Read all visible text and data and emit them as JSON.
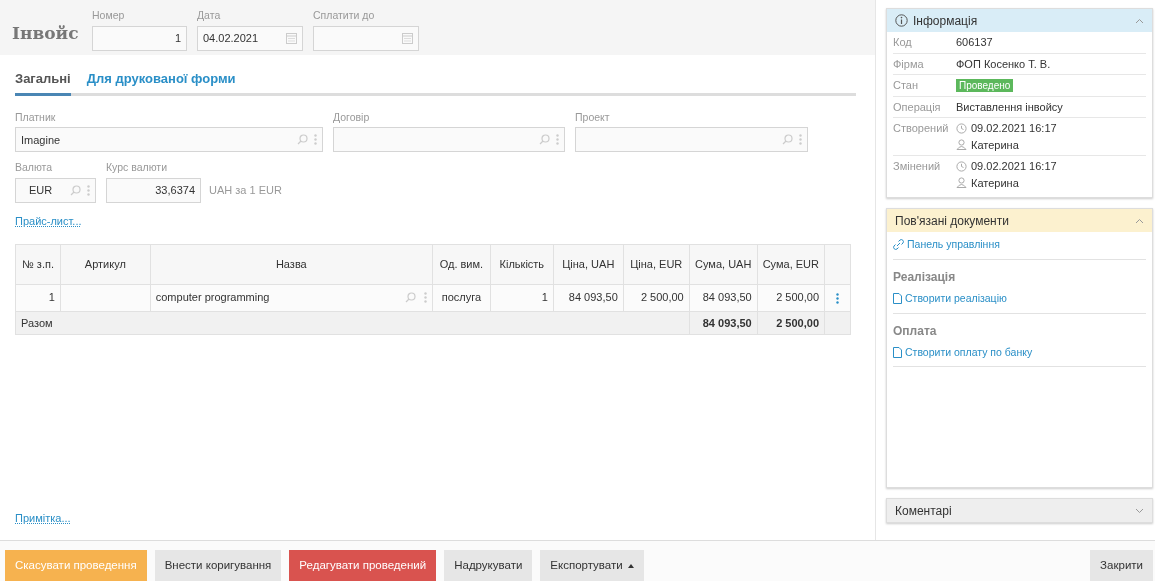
{
  "header": {
    "title": "Інвойс",
    "fields": [
      {
        "label": "Номер",
        "value": "1",
        "kind": "number"
      },
      {
        "label": "Дата",
        "value": "04.02.2021",
        "kind": "date"
      },
      {
        "label": "Сплатити до",
        "kind": "date"
      }
    ]
  },
  "tabs": [
    {
      "label": "Загальні",
      "selected": true
    },
    {
      "label": "Для друкованої форми",
      "selected": false
    }
  ],
  "fields": [
    {
      "label": "Платник",
      "value": "Imagine"
    },
    {
      "label": "Договір"
    },
    {
      "label": "Проект"
    }
  ],
  "currency": {
    "label": "Валюта",
    "value": "EUR"
  },
  "rate": {
    "label": "Курс валюти",
    "value": "33,6374",
    "unit": "UAH за 1 EUR"
  },
  "price_list_link": "Прайс-лист...",
  "table": {
    "columns": [
      "№ з.п.",
      "Артикул",
      "Назва",
      "Од. вим.",
      "Кількість",
      "Ціна, UAH",
      "Ціна, EUR",
      "Сума, UAH",
      "Сума, EUR"
    ],
    "rows": [
      {
        "cells": [
          "1",
          "",
          "computer programming",
          "послуга",
          "1",
          "84 093,50",
          "2 500,00",
          "84 093,50",
          "2 500,00"
        ]
      }
    ],
    "total": {
      "label": "Разом",
      "cells": [
        "84 093,50",
        "2 500,00"
      ]
    }
  },
  "note_link": "Примітка...",
  "sidebar": {
    "info": {
      "title": "Інформація",
      "expanded": true,
      "rows": [
        {
          "label": "Код",
          "kind": "text",
          "value": "606137"
        },
        {
          "label": "Фірма",
          "kind": "text",
          "value": "ФОП Косенко Т. В."
        },
        {
          "label": "Стан",
          "kind": "badge",
          "value": "Проведено"
        },
        {
          "label": "Операція",
          "kind": "text",
          "value": "Виставлення інвойсу"
        },
        {
          "label": "Створений",
          "kind": "audit",
          "value": "09.02.2021 16:17",
          "user": "Катерина"
        },
        {
          "label": "Змінений",
          "kind": "audit",
          "value": "09.02.2021 16:17",
          "user": "Катерина"
        }
      ]
    },
    "related": {
      "title": "Пов'язані документи",
      "expanded": true,
      "items": [
        {
          "kind": "link",
          "text": "Панель управління"
        },
        {
          "kind": "heading",
          "text": "Реалізація"
        },
        {
          "kind": "document",
          "text": "Створити реалізацію"
        },
        {
          "kind": "heading",
          "text": "Оплата"
        },
        {
          "kind": "document",
          "text": "Створити оплату по банку"
        }
      ]
    },
    "comments": {
      "title": "Коментарі",
      "expanded": false
    }
  },
  "buttons": [
    {
      "label": "Скасувати проведення",
      "color": "#f6b24f",
      "kind": "button"
    },
    {
      "label": "Внести коригування",
      "color": "#e6e6e6",
      "kind": "button"
    },
    {
      "label": "Редагувати проведений",
      "color": "#d9534f",
      "kind": "button"
    },
    {
      "label": "Надрукувати",
      "color": "#e6e6e6",
      "kind": "button"
    },
    {
      "label": "Експортувати",
      "color": "#e6e6e6",
      "kind": "dropdown"
    }
  ],
  "close_button": "Закрити"
}
